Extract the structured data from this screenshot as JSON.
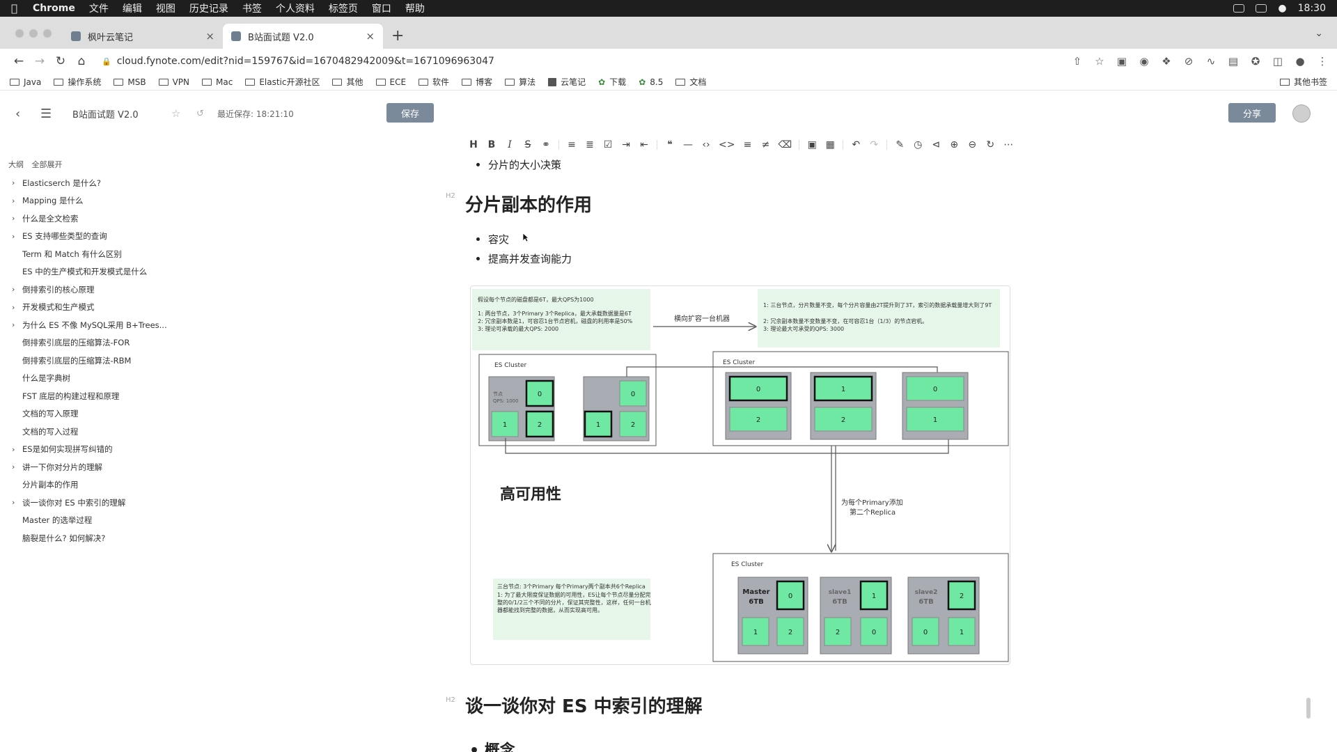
{
  "menubar": {
    "app": "Chrome",
    "items": [
      "文件",
      "编辑",
      "视图",
      "历史记录",
      "书签",
      "个人资料",
      "标签页",
      "窗口",
      "帮助"
    ],
    "time": "18:30"
  },
  "tabs": [
    {
      "label": "枫叶云笔记"
    },
    {
      "label": "B站面试题 V2.0"
    }
  ],
  "address": {
    "url": "cloud.fynote.com/edit?nid=159767&id=1670482942009&t=1671096963047"
  },
  "bookmarks": [
    "Java",
    "操作系统",
    "MSB",
    "VPN",
    "Mac",
    "Elastic开源社区",
    "其他",
    "ECE",
    "软件",
    "博客",
    "算法",
    "云笔记",
    "下载",
    "8.5",
    "文档"
  ],
  "other_bookmarks": "其他书签",
  "header": {
    "doc_title": "B站面试题 V2.0",
    "saved_status": "最近保存: 18:21:10",
    "save_label": "保存",
    "share_label": "分享"
  },
  "outline": {
    "title": "大纲",
    "expand_all": "全部展开",
    "items": [
      {
        "label": "Elasticserch 是什么?",
        "expandable": true
      },
      {
        "label": "Mapping 是什么",
        "expandable": true
      },
      {
        "label": "什么是全文检索",
        "expandable": true
      },
      {
        "label": "ES 支持哪些类型的查询",
        "expandable": true
      },
      {
        "label": "Term 和 Match 有什么区别",
        "expandable": false
      },
      {
        "label": "ES 中的生产模式和开发模式是什么",
        "expandable": false
      },
      {
        "label": "倒排索引的核心原理",
        "expandable": true
      },
      {
        "label": "开发模式和生产模式",
        "expandable": true
      },
      {
        "label": "为什么 ES 不像 MySQL采用 B+Trees...",
        "expandable": true
      },
      {
        "label": "倒排索引底层的压缩算法-FOR",
        "expandable": false
      },
      {
        "label": "倒排索引底层的压缩算法-RBM",
        "expandable": false
      },
      {
        "label": "什么是字典树",
        "expandable": false
      },
      {
        "label": "FST 底层的构建过程和原理",
        "expandable": false
      },
      {
        "label": "文档的写入原理",
        "expandable": false
      },
      {
        "label": "文档的写入过程",
        "expandable": false
      },
      {
        "label": "ES是如何实现拼写纠错的",
        "expandable": true
      },
      {
        "label": "讲一下你对分片的理解",
        "expandable": true
      },
      {
        "label": "分片副本的作用",
        "expandable": false
      },
      {
        "label": "谈一谈你对 ES 中索引的理解",
        "expandable": true
      },
      {
        "label": "Master 的选举过程",
        "expandable": false
      },
      {
        "label": "脑裂是什么? 如何解决?",
        "expandable": false
      }
    ]
  },
  "content": {
    "prev_bullet": "分片的大小决策",
    "heading1": "分片副本的作用",
    "bullets": [
      "容灾",
      "提高并发查询能力"
    ],
    "heading2": "谈一谈你对 ES 中索引的理解",
    "heading3_partial": "概念"
  },
  "figure": {
    "note1": [
      "假设每个节点的磁盘都是6T，最大QPS为1000",
      "1: 两台节点，3个Primary 3个Replica，最大承载数据量是6T",
      "2: 冗余副本数是1，可容忍1台节点宕机，磁盘的利用率是50%",
      "3: 理论可承载的最大QPS: 2000"
    ],
    "arrow_label": "横向扩容一台机器",
    "note2": [
      "1: 三台节点，分片数量不变，每个分片容量由2T提升到了3T，索引的数据承载量增大到了9T",
      "2: 冗余副本数量不变数量不变，在可容忍1台（1/3）的节点宕机。",
      "3: 理论最大可承受的QPS: 3000"
    ],
    "cluster_label": "ES Cluster",
    "node_label_small": "节点",
    "node_label_qps": "QPS: 1000",
    "high_availability": "高可用性",
    "down_label_1": "为每个Primary添加",
    "down_label_2": "第二个Replica",
    "note3": [
      "三台节点: 3个Primary 每个Primary两个副本共6个Replica",
      "1: 为了最大限度保证数据的可用性，ES让每个节点尽量分配完",
      "整的0/1/2三个不同的分片，保证其完整性，这样，任何一台机",
      "器都能找到完整的数据，从而实现高可用。"
    ],
    "master_label": "Master",
    "slave1_label": "slave1",
    "slave2_label": "slave2",
    "node_size": "6TB",
    "cluster_a": [
      [
        "0"
      ],
      [
        "1",
        "2"
      ]
    ],
    "cluster_b_nodes": [
      [
        "0",
        "2"
      ],
      [
        "1",
        "2"
      ],
      [
        "0",
        "1"
      ]
    ],
    "cluster_c_nodes": [
      [
        "0",
        "1",
        "2"
      ],
      [
        "1",
        "2",
        "0"
      ],
      [
        "2",
        "0",
        "1"
      ]
    ]
  },
  "colors": {
    "shard_green": "#6fe8a3",
    "note_green": "#e6f6e9",
    "node_gray": "#a9acb2",
    "accent": "#7b8a9a"
  }
}
